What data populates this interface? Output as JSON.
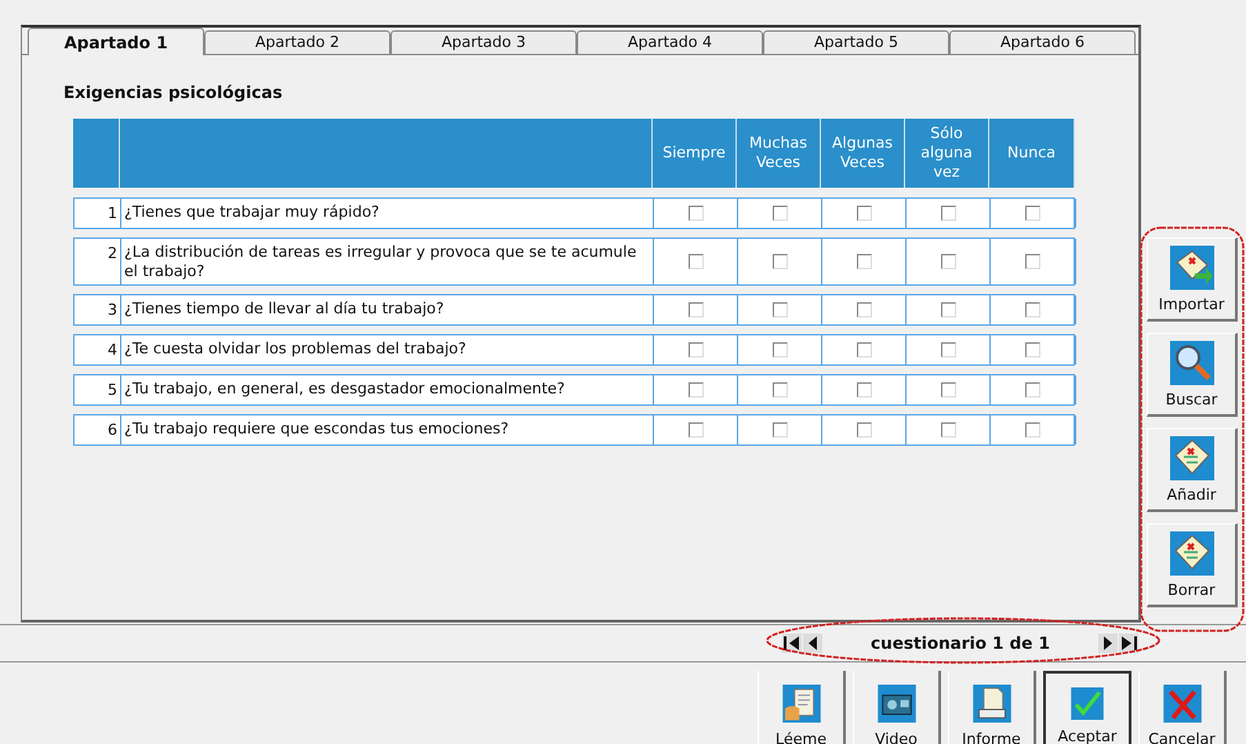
{
  "tabs": [
    {
      "label": "Apartado 1",
      "selected": true
    },
    {
      "label": "Apartado 2",
      "selected": false
    },
    {
      "label": "Apartado 3",
      "selected": false
    },
    {
      "label": "Apartado 4",
      "selected": false
    },
    {
      "label": "Apartado 5",
      "selected": false
    },
    {
      "label": "Apartado 6",
      "selected": false
    }
  ],
  "section_title": "Exigencias psicológicas",
  "table": {
    "columns": [
      "Siempre",
      "Muchas Veces",
      "Algunas Veces",
      "Sólo alguna vez",
      "Nunca"
    ],
    "rows": [
      {
        "number": "1",
        "question": "¿Tienes que trabajar muy rápido?",
        "answers": [
          {
            "checked": false
          },
          {
            "checked": false
          },
          {
            "checked": false
          },
          {
            "checked": false
          },
          {
            "checked": false
          }
        ]
      },
      {
        "number": "2",
        "question": "¿La distribución de tareas es irregular y provoca que se te acumule el trabajo?",
        "answers": [
          {
            "checked": false
          },
          {
            "checked": false
          },
          {
            "checked": false
          },
          {
            "checked": false
          },
          {
            "checked": false
          }
        ]
      },
      {
        "number": "3",
        "question": "¿Tienes tiempo de llevar al día tu trabajo?",
        "answers": [
          {
            "checked": false
          },
          {
            "checked": false
          },
          {
            "checked": false
          },
          {
            "checked": false
          },
          {
            "checked": false
          }
        ]
      },
      {
        "number": "4",
        "question": "¿Te cuesta olvidar los problemas del trabajo?",
        "answers": [
          {
            "checked": false
          },
          {
            "checked": false
          },
          {
            "checked": false
          },
          {
            "checked": false
          },
          {
            "checked": false
          }
        ]
      },
      {
        "number": "5",
        "question": "¿Tu trabajo, en general, es desgastador emocionalmente?",
        "answers": [
          {
            "checked": false
          },
          {
            "checked": false
          },
          {
            "checked": false
          },
          {
            "checked": false
          },
          {
            "checked": false
          }
        ]
      },
      {
        "number": "6",
        "question": "¿Tu trabajo requiere que escondas tus emociones?",
        "answers": [
          {
            "checked": false
          },
          {
            "checked": false
          },
          {
            "checked": false
          },
          {
            "checked": false
          },
          {
            "checked": false
          }
        ]
      }
    ]
  },
  "side_buttons": [
    {
      "kind": "import",
      "label": "Importar"
    },
    {
      "kind": "search",
      "label": "Buscar"
    },
    {
      "kind": "add",
      "label": "Añadir"
    },
    {
      "kind": "delete",
      "label": "Borrar"
    }
  ],
  "navigator": {
    "label": "cuestionario 1 de 1"
  },
  "bottom_buttons": [
    {
      "kind": "readme",
      "label": "Léeme",
      "default": false
    },
    {
      "kind": "video",
      "label": "Video",
      "default": false
    },
    {
      "kind": "report",
      "label": "Informe",
      "default": false
    },
    {
      "kind": "accept",
      "label": "Aceptar",
      "default": true
    },
    {
      "kind": "cancel",
      "label": "Cancelar",
      "default": false
    }
  ]
}
